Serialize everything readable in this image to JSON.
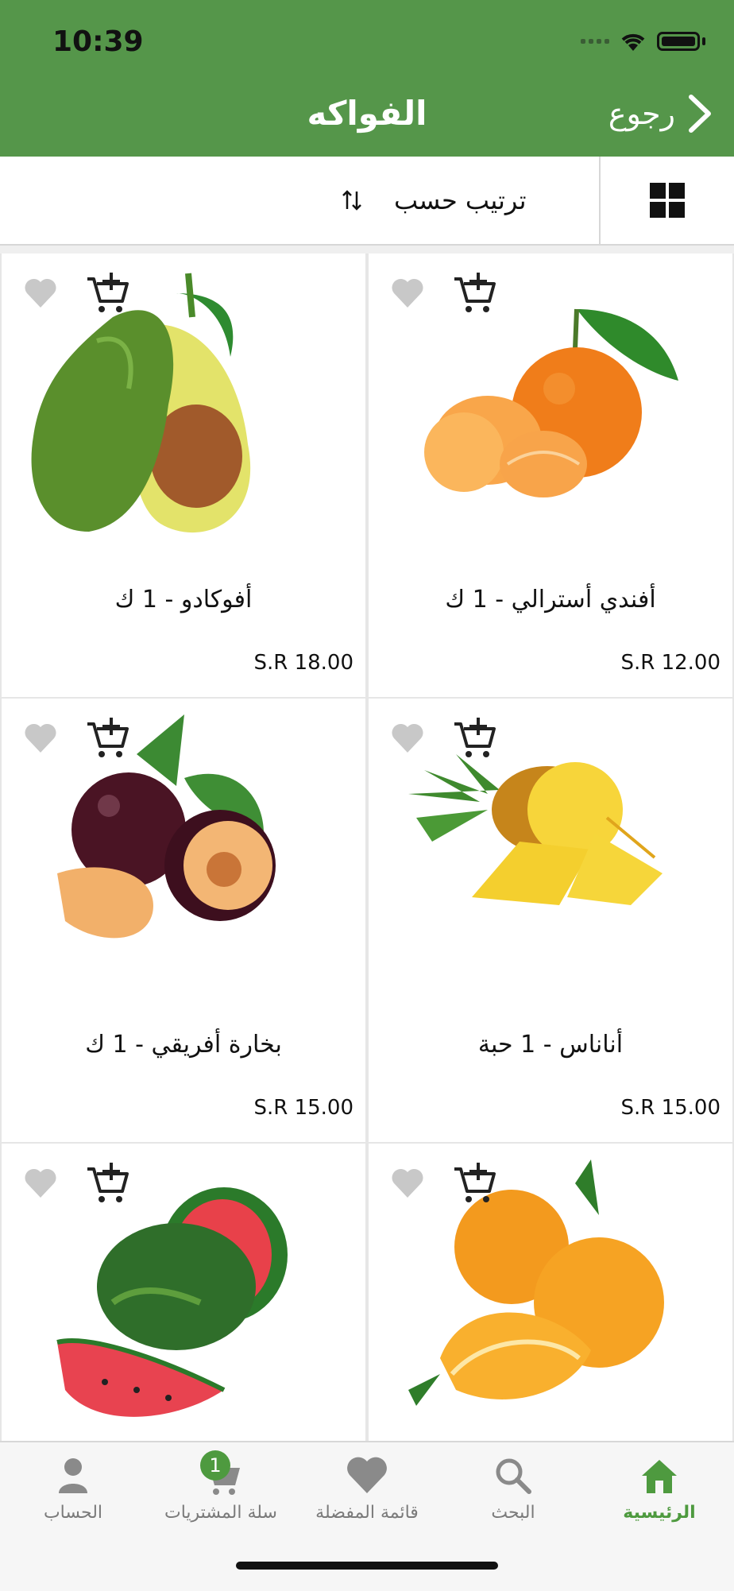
{
  "status_bar": {
    "time": "10:39"
  },
  "header": {
    "title": "الفواكه",
    "back_label": "رجوع"
  },
  "sortbar": {
    "sort_label": "ترتيب حسب"
  },
  "products": [
    {
      "name": "أفندي أسترالي - 1 ك",
      "price": "S.R 12.00",
      "image": "tangerine"
    },
    {
      "name": "أفوكادو - 1 ك",
      "price": "S.R 18.00",
      "image": "avocado"
    },
    {
      "name": "أناناس - 1 حبة",
      "price": "S.R 15.00",
      "image": "pineapple"
    },
    {
      "name": "بخارة أفريقي - 1 ك",
      "price": "S.R 15.00",
      "image": "plum"
    },
    {
      "name": "",
      "price": "",
      "image": "orange"
    },
    {
      "name": "",
      "price": "",
      "image": "watermelon"
    }
  ],
  "bottom_nav": {
    "home": "الرئيسية",
    "search": "البحث",
    "favorites": "قائمة المفضلة",
    "cart": "سلة المشتريات",
    "cart_badge": "1",
    "account": "الحساب"
  },
  "colors": {
    "brand_green": "#55964a",
    "active_tab": "#4e9a3f"
  }
}
